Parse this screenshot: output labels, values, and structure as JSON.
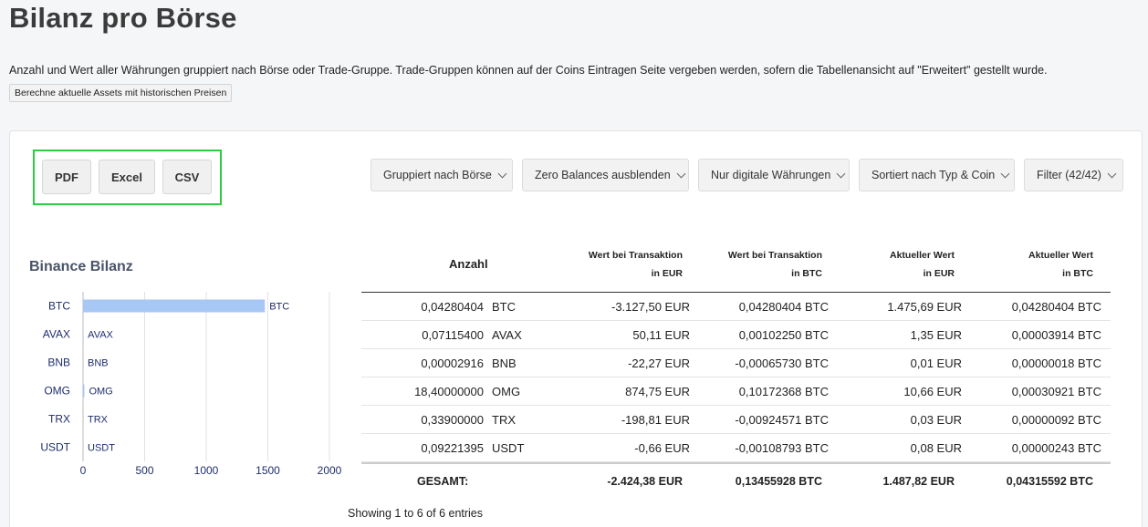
{
  "page": {
    "title": "Bilanz pro Börse",
    "description": "Anzahl und Wert aller Währungen gruppiert nach Börse oder Trade-Gruppe. Trade-Gruppen können auf der Coins Eintragen Seite vergeben werden, sofern die Tabellenansicht auf \"Erweitert\" gestellt wurde.",
    "calc_button": "Berechne aktuelle Assets mit historischen Preisen"
  },
  "export": {
    "pdf": "PDF",
    "excel": "Excel",
    "csv": "CSV"
  },
  "filters": {
    "group": "Gruppiert nach Börse",
    "zero": "Zero Balances ausblenden",
    "digital": "Nur digitale Währungen",
    "sort": "Sortiert nach Typ & Coin",
    "filter": "Filter (42/42)"
  },
  "chart_title": "Binance Bilanz",
  "chart_data": {
    "type": "bar",
    "orientation": "horizontal",
    "title": "Binance Bilanz",
    "categories": [
      "BTC",
      "AVAX",
      "BNB",
      "OMG",
      "TRX",
      "USDT"
    ],
    "values": [
      1475.69,
      1.35,
      0.01,
      10.66,
      0.03,
      0.08
    ],
    "xlim": [
      0,
      2000
    ],
    "xticks": [
      "0",
      "500",
      "1000",
      "1500",
      "2000"
    ],
    "grid": true,
    "bar_color": "#a7c7f5"
  },
  "table": {
    "headers": {
      "anzahl": "Anzahl",
      "wert_tx_eur_1": "Wert bei Transaktion",
      "wert_tx_eur_2": "in EUR",
      "wert_tx_btc_1": "Wert bei Transaktion",
      "wert_tx_btc_2": "in BTC",
      "akt_eur_1": "Aktueller Wert",
      "akt_eur_2": "in EUR",
      "akt_btc_1": "Aktueller Wert",
      "akt_btc_2": "in BTC"
    },
    "rows": [
      {
        "amount": "0,04280404",
        "coin": "BTC",
        "tx_eur": "-3.127,50 EUR",
        "tx_btc": "0,04280404 BTC",
        "cur_eur": "1.475,69 EUR",
        "cur_btc": "0,04280404 BTC"
      },
      {
        "amount": "0,07115400",
        "coin": "AVAX",
        "tx_eur": "50,11 EUR",
        "tx_btc": "0,00102250 BTC",
        "cur_eur": "1,35 EUR",
        "cur_btc": "0,00003914 BTC"
      },
      {
        "amount": "0,00002916",
        "coin": "BNB",
        "tx_eur": "-22,27 EUR",
        "tx_btc": "-0,00065730 BTC",
        "cur_eur": "0,01 EUR",
        "cur_btc": "0,00000018 BTC"
      },
      {
        "amount": "18,40000000",
        "coin": "OMG",
        "tx_eur": "874,75 EUR",
        "tx_btc": "0,10172368 BTC",
        "cur_eur": "10,66 EUR",
        "cur_btc": "0,00030921 BTC"
      },
      {
        "amount": "0,33900000",
        "coin": "TRX",
        "tx_eur": "-198,81 EUR",
        "tx_btc": "-0,00924571 BTC",
        "cur_eur": "0,03 EUR",
        "cur_btc": "0,00000092 BTC"
      },
      {
        "amount": "0,09221395",
        "coin": "USDT",
        "tx_eur": "-0,66 EUR",
        "tx_btc": "-0,00108793 BTC",
        "cur_eur": "0,08 EUR",
        "cur_btc": "0,00000243 BTC"
      }
    ],
    "footer": {
      "label": "GESAMT:",
      "tx_eur": "-2.424,38 EUR",
      "tx_btc": "0,13455928 BTC",
      "cur_eur": "1.487,82 EUR",
      "cur_btc": "0,04315592 BTC"
    },
    "info": "Showing 1 to 6 of 6 entries"
  }
}
